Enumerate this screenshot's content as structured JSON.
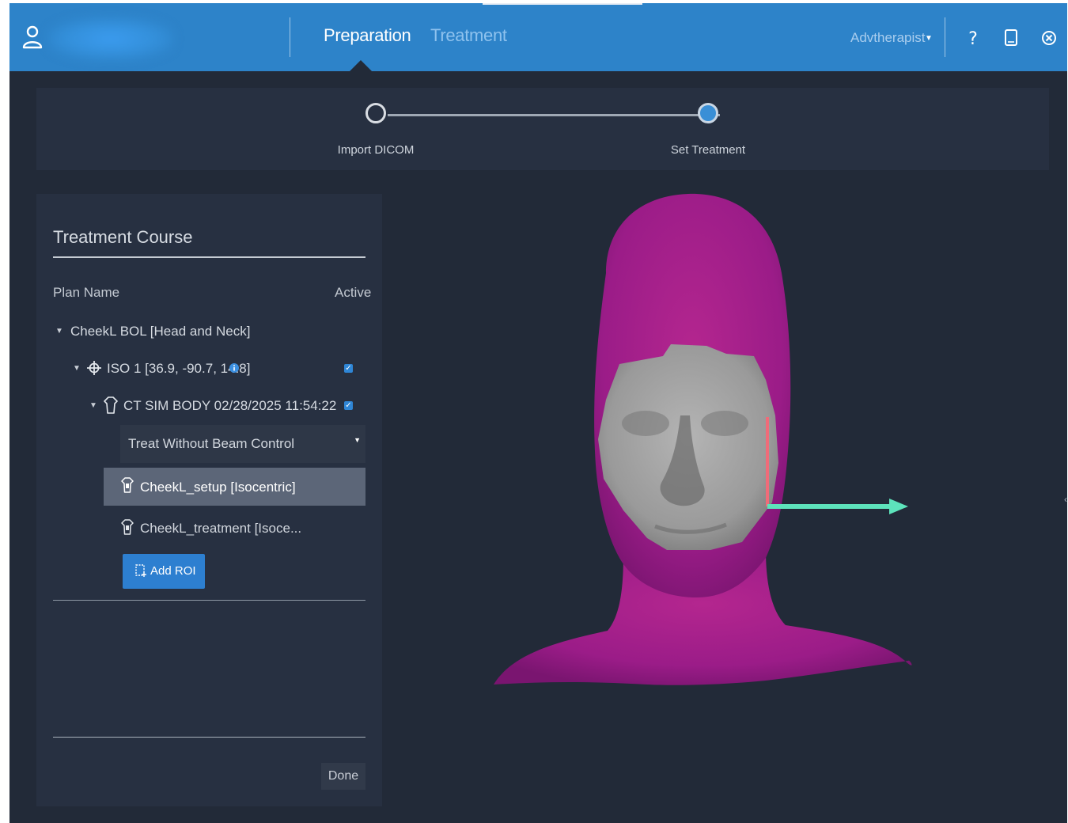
{
  "header": {
    "tabs": [
      {
        "label": "Preparation",
        "active": true
      },
      {
        "label": "Treatment",
        "active": false
      }
    ],
    "user": "Advtherapist",
    "icons": [
      "user-icon",
      "help-icon",
      "tablet-icon",
      "close-circle-icon"
    ]
  },
  "stepper": {
    "steps": [
      {
        "label": "Import DICOM",
        "state": "done"
      },
      {
        "label": "Set Treatment",
        "state": "current"
      }
    ]
  },
  "panel": {
    "title": "Treatment Course",
    "columns": {
      "plan_name": "Plan Name",
      "active": "Active"
    },
    "plan": "CheekL BOL [Head and Neck]",
    "iso": {
      "label": "ISO 1 [36.9, -90.7, 14.8]",
      "active": true
    },
    "ct": {
      "label": "CT SIM BODY 02/28/2025 11:54:22",
      "active": true
    },
    "beam_control": {
      "selected": "Treat Without Beam Control"
    },
    "rois": [
      {
        "label": "CheekL_setup [Isocentric]",
        "selected": true
      },
      {
        "label": "CheekL_treatment [Isoce...",
        "selected": false
      }
    ],
    "add_roi_label": "Add ROI",
    "done_label": "Done"
  },
  "colors": {
    "header_bg": "#2d83c9",
    "app_bg": "#222a38",
    "panel_bg": "#273041",
    "accent": "#2d7fd0",
    "body_surface": "#9b1c88",
    "face_surface": "#9c9c9c",
    "axis_x": "#5de3bb",
    "axis_y": "#f06b79"
  },
  "viewport": {
    "content": "3D head surface model with highlighted face region",
    "axes": [
      "x-axis-arrow",
      "y-axis-arrow"
    ]
  }
}
